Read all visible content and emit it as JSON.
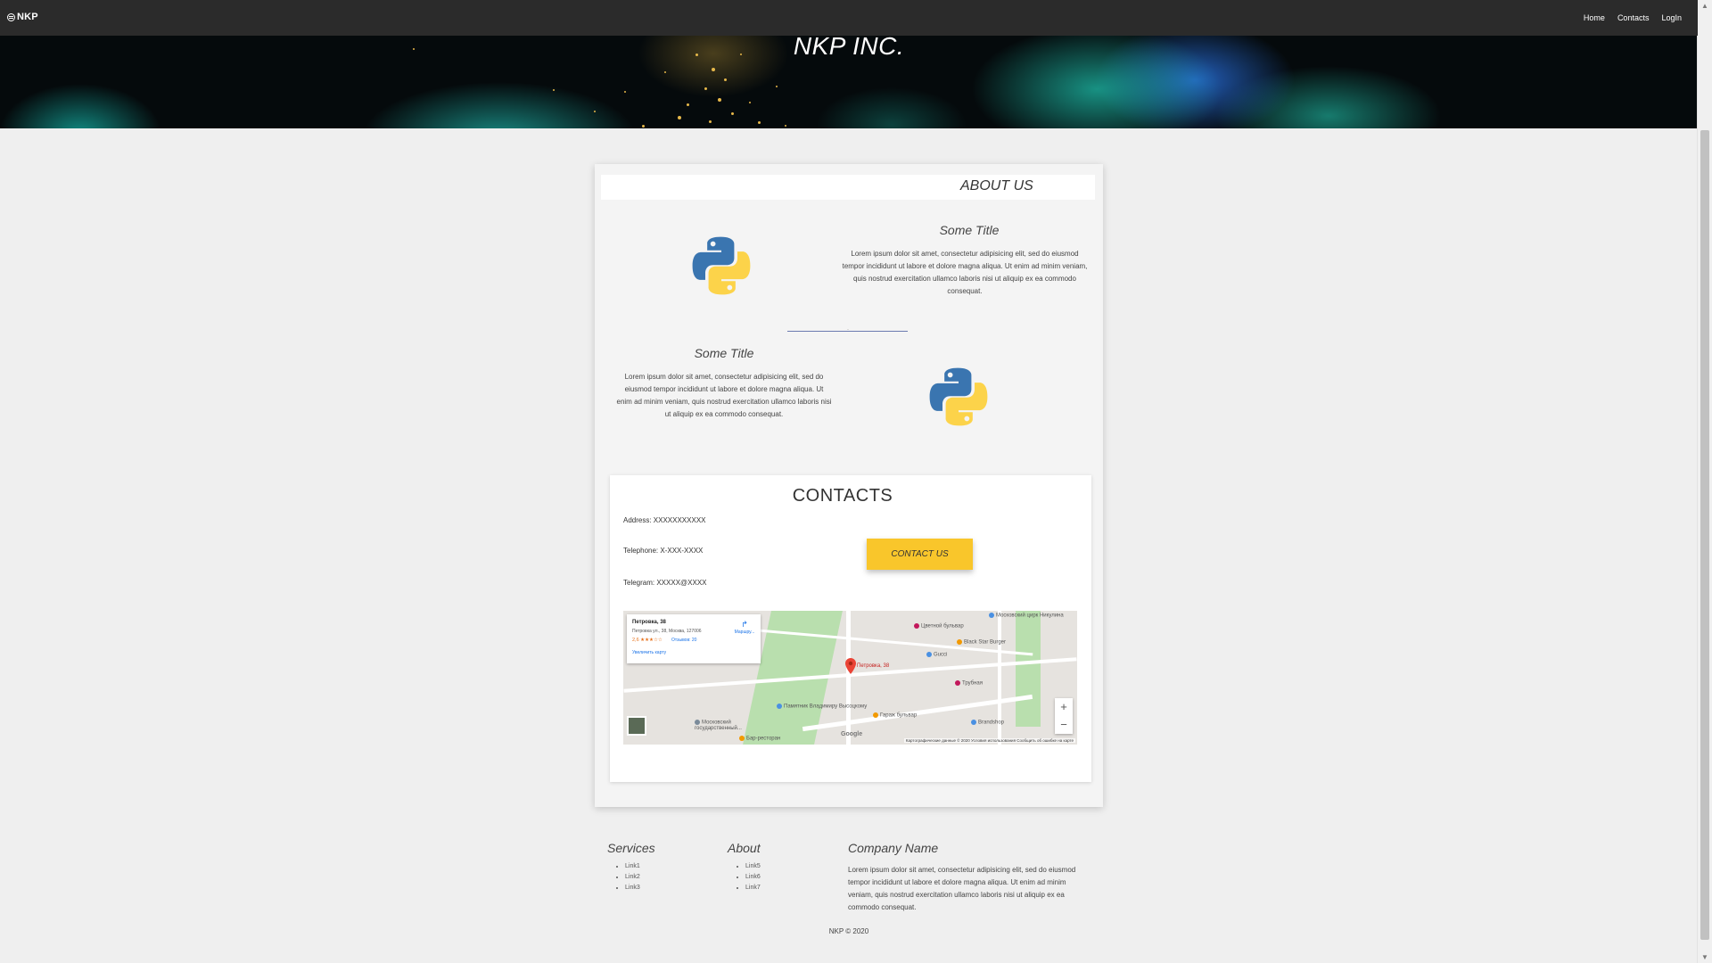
{
  "navbar": {
    "brand": "NKP",
    "links": [
      "Home",
      "Contacts",
      "LogIn"
    ]
  },
  "hero": {
    "title": "NKP INC."
  },
  "about": {
    "title": "ABOUT US",
    "features": [
      {
        "title": "Some Title",
        "text": "Lorem ipsum dolor sit amet, consectetur adipisicing elit, sed do eiusmod tempor incididunt ut labore et dolore magna aliqua. Ut enim ad minim veniam, quis nostrud exercitation ullamco laboris nisi ut aliquip ex ea commodo consequat."
      },
      {
        "title": "Some Title",
        "text": "Lorem ipsum dolor sit amet, consectetur adipisicing elit, sed do eiusmod tempor incididunt ut labore et dolore magna aliqua. Ut enim ad minim veniam, quis nostrud exercitation ullamco laboris nisi ut aliquip ex ea commodo consequat."
      }
    ]
  },
  "contacts": {
    "title": "CONTACTS",
    "address": "Address: XXXXXXXXXXX",
    "telephone": "Telephone: X-XXX-XXXX",
    "telegram": "Telegram: XXXXX@XXXX",
    "button_label": "CONTACT US"
  },
  "map": {
    "place_name": "Петровка, 38",
    "place_address": "Петровка ул., 38, Москва, 127006",
    "rating": "2,6 ★★★☆☆",
    "reviews": "Отзывов: 20",
    "enlarge": "Увеличить карту",
    "route": "Маршру...",
    "marker_label": "Петровка, 38",
    "zoom_in": "+",
    "zoom_out": "−",
    "google": "Google",
    "attribution": "Картографические данные © 2020   Условия использования   Сообщить об ошибке на карте",
    "pois": [
      "Цветной бульвар",
      "Московский цирк Никулина",
      "Black Star Burger",
      "Gucci",
      "Трубная",
      "Памятник Владимиру Высоцкому",
      "Гараж бульвар",
      "Brandshop",
      "Московский государственный...",
      "Бар-ресторан"
    ],
    "colors": {
      "park": "#b9dfae",
      "pin": "#ea4335",
      "poi_food": "#f29900",
      "poi_shop": "#4a90e2",
      "poi_metro": "#c2185b"
    }
  },
  "footer": {
    "services_title": "Services",
    "services_links": [
      "Link1",
      "Link2",
      "Link3"
    ],
    "about_title": "About",
    "about_links": [
      "Link5",
      "Link6",
      "Link7"
    ],
    "company_title": "Company Name",
    "company_text": "Lorem ipsum dolor sit amet, consectetur adipisicing elit, sed do eiusmod tempor incididunt ut labore et dolore magna aliqua. Ut enim ad minim veniam, quis nostrud exercitation ullamco laboris nisi ut aliquip ex ea commodo consequat.",
    "copyright": "NKP © 2020"
  },
  "colors": {
    "navbar": "#2b2b2b",
    "accent_button": "#f9c62b",
    "page_bg": "#efefef"
  }
}
